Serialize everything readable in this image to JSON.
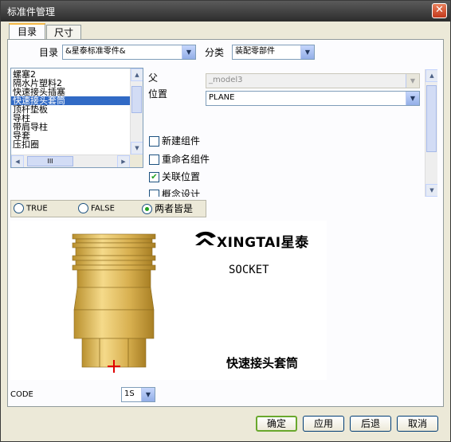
{
  "window": {
    "title": "标准件管理",
    "close_icon": "close-icon"
  },
  "tabs": [
    {
      "label": "目录"
    },
    {
      "label": "尺寸"
    }
  ],
  "catalog": {
    "label": "目录",
    "value": "&星泰标准零件&",
    "category_label": "分类",
    "category_value": "装配零部件"
  },
  "parts_list": [
    "螺塞2",
    "隔水片塑料2",
    "快速接头插塞",
    "快速接头套筒",
    "顶杆垫板",
    "导柱",
    "带肩导柱",
    "导套",
    "压扣圈"
  ],
  "selected_index": 3,
  "parent": {
    "label": "父",
    "value": "_model3"
  },
  "position": {
    "label": "位置",
    "value": "PLANE"
  },
  "checkboxes": [
    {
      "label": "新建组件",
      "checked": false
    },
    {
      "label": "重命名组件",
      "checked": false
    },
    {
      "label": "关联位置",
      "checked": true
    },
    {
      "label": "概念设计",
      "checked": false
    }
  ],
  "radios": [
    {
      "label": "TRUE",
      "selected": false
    },
    {
      "label": "FALSE",
      "selected": false
    },
    {
      "label": "两者皆是",
      "selected": true
    }
  ],
  "preview": {
    "brand": "XINGTAI星泰",
    "part_code": "SOCKET",
    "part_name": "快速接头套筒"
  },
  "code": {
    "label": "CODE",
    "value": "1S"
  },
  "buttons": {
    "ok": "确定",
    "apply": "应用",
    "back": "后退",
    "cancel": "取消"
  }
}
